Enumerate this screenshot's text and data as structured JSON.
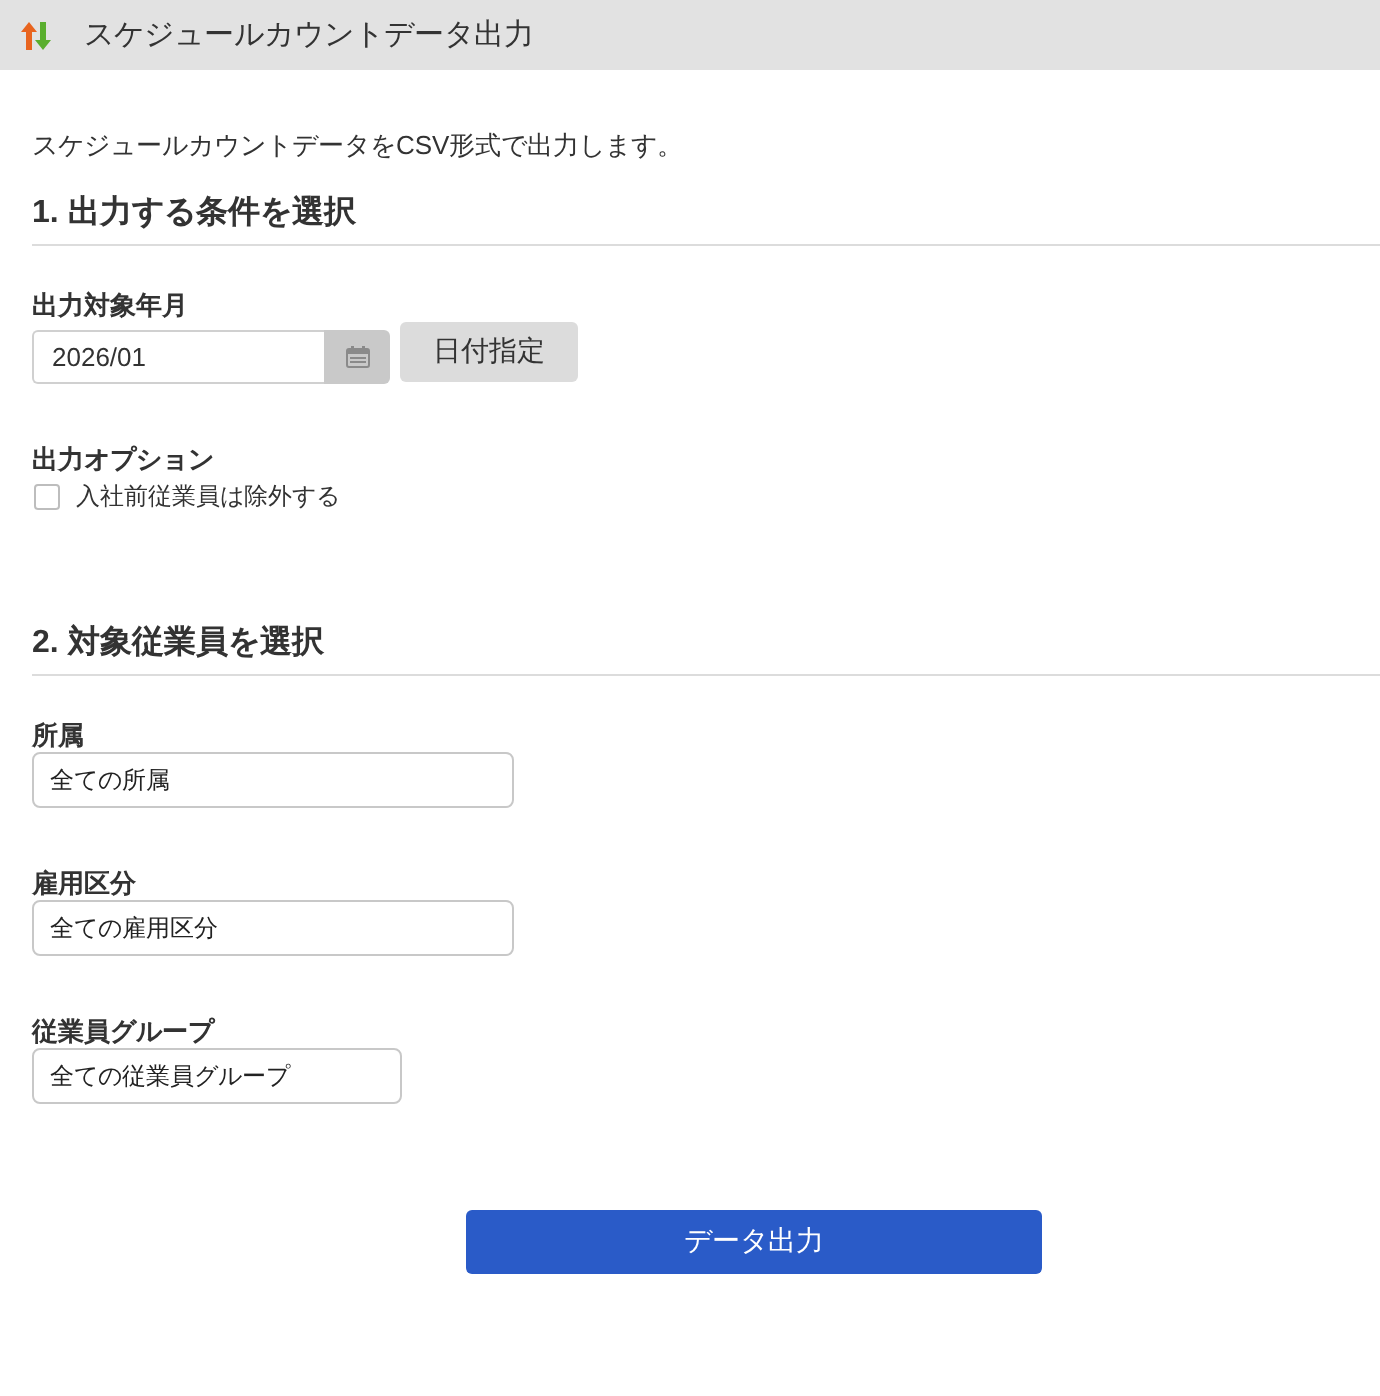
{
  "window": {
    "title": "スケジュールカウントデータ出力"
  },
  "description": "スケジュールカウントデータをCSV形式で出力します。",
  "sections": [
    {
      "heading": "1. 出力する条件を選択",
      "fields": [
        {
          "kind": "month",
          "label": "出力対象年月",
          "value": "2026/01",
          "button": "日付指定"
        },
        {
          "kind": "options",
          "label": "出力オプション",
          "options": [
            {
              "label": "入社前従業員は除外する",
              "checked": false
            }
          ]
        }
      ]
    },
    {
      "heading": "2. 対象従業員を選択",
      "fields": [
        {
          "kind": "select",
          "label": "所属",
          "value": "全ての所属"
        },
        {
          "kind": "select",
          "label": "雇用区分",
          "value": "全ての雇用区分"
        },
        {
          "kind": "select",
          "label": "従業員グループ",
          "value": "全ての従業員グループ"
        }
      ]
    }
  ],
  "submit": "データ出力"
}
